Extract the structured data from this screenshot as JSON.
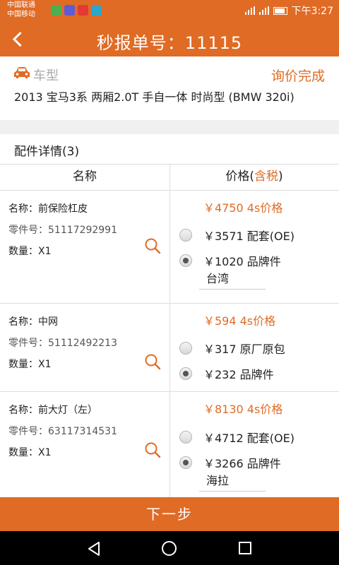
{
  "status_bar": {
    "carrier1": "中国联通",
    "carrier2": "中国移动",
    "time": "下午3:27"
  },
  "header": {
    "back_icon": "chevron-left-icon",
    "title": "秒报单号：11115"
  },
  "vehicle": {
    "icon": "car-icon",
    "label": "车型",
    "status": "询价完成",
    "model": "2013 宝马3系 两厢2.0T 手自一体 时尚型 (BMW 320i)"
  },
  "parts": {
    "heading": "配件详情(3)",
    "col_name": "名称",
    "col_price": "价格(",
    "col_price_tax": "含税",
    "col_price_end": ")",
    "items": [
      {
        "name": "名称：前保险杠皮",
        "part_no": "零件号：51117292991",
        "qty": "数量：X1",
        "price_4s": "￥4750 4s价格",
        "options": [
          {
            "label": "￥3571 配套(OE)",
            "selected": false
          },
          {
            "label": "￥1020 品牌件",
            "selected": true
          }
        ],
        "brand": "台湾"
      },
      {
        "name": "名称：中网",
        "part_no": "零件号：51112492213",
        "qty": "数量：X1",
        "price_4s": "￥594 4s价格",
        "options": [
          {
            "label": "￥317 原厂原包",
            "selected": false
          },
          {
            "label": "￥232 品牌件",
            "selected": true
          }
        ]
      },
      {
        "name": "名称：前大灯（左）",
        "part_no": "零件号：63117314531",
        "qty": "数量：X1",
        "price_4s": "￥8130 4s价格",
        "options": [
          {
            "label": "￥4712 配套(OE)",
            "selected": false
          },
          {
            "label": "￥3266 品牌件",
            "selected": true
          }
        ],
        "brand": "海拉"
      }
    ]
  },
  "footer": {
    "next_label": "下一步"
  },
  "colors": {
    "accent": "#e06b25"
  }
}
